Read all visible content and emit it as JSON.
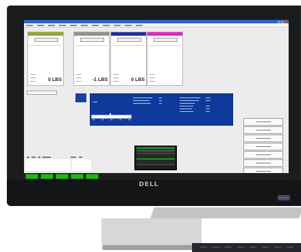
{
  "monitor": {
    "brand": "DELL"
  },
  "cards": [
    {
      "header_color": "#94a830",
      "weight": "0 LBS"
    },
    {
      "header_color": "#909090",
      "weight": "-1 LBS"
    },
    {
      "header_color": "#1f2ca8",
      "weight": "0 LBS"
    },
    {
      "header_color": "#e024c8",
      "weight": ""
    }
  ],
  "center_box_stripes": [
    "#1d8a1d",
    "#4c4c4c",
    "#3f3f3f",
    "#2a2a2a",
    "#1e7a1e",
    "#2e2e2e",
    "#3c3c3c",
    "#1f1f1f"
  ],
  "right_buttons": 7,
  "bottom_tabs": 5,
  "colors": {
    "screen_blue_panel": "#0f3a9c",
    "tab_green": "#24b51c",
    "titlebar_blue": "#2c64c8"
  }
}
